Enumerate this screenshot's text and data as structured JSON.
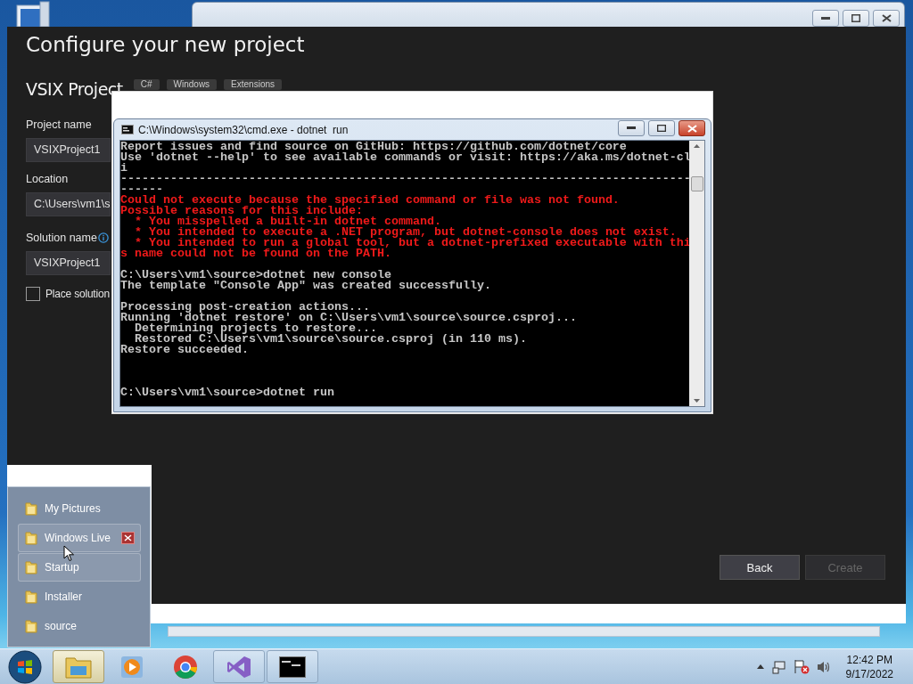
{
  "dialog": {
    "title": "Configure your new project",
    "template": "VSIX Project",
    "tags": [
      "C#",
      "Windows",
      "Extensions"
    ],
    "fields": [
      {
        "label": "Project name",
        "value": "VSIXProject1",
        "info": false
      },
      {
        "label": "Location",
        "value": "C:\\Users\\vm1\\s",
        "info": false
      },
      {
        "label": "Solution name",
        "value": "VSIXProject1",
        "info": true
      }
    ],
    "checkbox": {
      "label": "Place solution",
      "checked": false
    },
    "buttons": [
      {
        "label": "Back",
        "disabled": false
      },
      {
        "label": "Create",
        "disabled": true
      }
    ]
  },
  "console": {
    "title": "C:\\Windows\\system32\\cmd.exe - dotnet  run",
    "lines": [
      {
        "kind": "normal",
        "text": "Report issues and find source on GitHub: https://github.com/dotnet/core"
      },
      {
        "kind": "normal",
        "text": "Use 'dotnet --help' to see available commands or visit: https://aka.ms/dotnet-cl"
      },
      {
        "kind": "normal",
        "text": "i"
      },
      {
        "kind": "normal",
        "text": "--------------------------------------------------------------------------------"
      },
      {
        "kind": "normal",
        "text": "------"
      },
      {
        "kind": "error",
        "text": "Could not execute because the specified command or file was not found."
      },
      {
        "kind": "error",
        "text": "Possible reasons for this include:"
      },
      {
        "kind": "error",
        "text": "  * You misspelled a built-in dotnet command."
      },
      {
        "kind": "error",
        "text": "  * You intended to execute a .NET program, but dotnet-console does not exist."
      },
      {
        "kind": "error",
        "text": "  * You intended to run a global tool, but a dotnet-prefixed executable with thi"
      },
      {
        "kind": "error",
        "text": "s name could not be found on the PATH."
      },
      {
        "kind": "blank"
      },
      {
        "kind": "normal",
        "text": "C:\\Users\\vm1\\source>dotnet new console"
      },
      {
        "kind": "normal",
        "text": "The template \"Console App\" was created successfully."
      },
      {
        "kind": "blank"
      },
      {
        "kind": "normal",
        "text": "Processing post-creation actions..."
      },
      {
        "kind": "normal",
        "text": "Running 'dotnet restore' on C:\\Users\\vm1\\source\\source.csproj..."
      },
      {
        "kind": "normal",
        "text": "  Determining projects to restore..."
      },
      {
        "kind": "normal",
        "text": "  Restored C:\\Users\\vm1\\source\\source.csproj (in 110 ms)."
      },
      {
        "kind": "normal",
        "text": "Restore succeeded."
      },
      {
        "kind": "blank"
      },
      {
        "kind": "blank"
      },
      {
        "kind": "blank"
      },
      {
        "kind": "normal",
        "text": "C:\\Users\\vm1\\source>dotnet run"
      }
    ]
  },
  "jump_list": {
    "items": [
      {
        "label": "My Pictures",
        "highlighted": false,
        "remove_button": false
      },
      {
        "label": "Windows Live",
        "highlighted": true,
        "remove_button": true
      },
      {
        "label": "Startup",
        "highlighted": true,
        "remove_button": false
      },
      {
        "label": "Installer",
        "highlighted": false,
        "remove_button": false
      },
      {
        "label": "source",
        "highlighted": false,
        "remove_button": false
      }
    ]
  },
  "taskbar": {
    "apps": [
      {
        "kind": "explorer",
        "running": true,
        "active": true
      },
      {
        "kind": "media",
        "running": false,
        "active": false
      },
      {
        "kind": "browser",
        "running": false,
        "active": false
      },
      {
        "kind": "studio",
        "running": true,
        "active": false
      },
      {
        "kind": "terminal",
        "running": true,
        "active": false
      }
    ],
    "clock": {
      "time": "12:42 PM",
      "date": "9/17/2022"
    }
  }
}
